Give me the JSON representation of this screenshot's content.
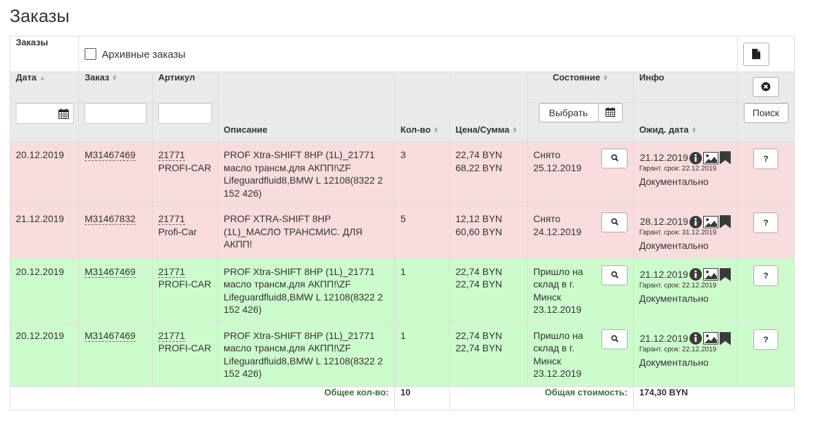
{
  "page_title": "Заказы",
  "top": {
    "label": "Заказы",
    "archive_label": "Архивные заказы"
  },
  "headers": {
    "date": "Дата",
    "order": "Заказ",
    "article": "Артикул",
    "description": "Описание",
    "qty": "Кол-во",
    "price": "Цена/Сумма",
    "status": "Состояние",
    "info": "Инфо",
    "expected": "Ожид. дата",
    "choose_button": "Выбрать",
    "search_button": "Поиск"
  },
  "rows": [
    {
      "state": "red",
      "date": "20.12.2019",
      "order": "M31467469",
      "article_code": "21771",
      "article_brand": "PROFI-CAR",
      "description": "PROF Xtra-SHIFT 8HP (1L)_21771 масло трансм.для АКПП!\\ZF Lifeguardfluid8,BMW L 12108(8322 2 152 426)",
      "qty": "3",
      "price": "22,74 BYN",
      "sum": "68,22 BYN",
      "status_text": "Снято",
      "status_date": "25.12.2019",
      "expected_date": "21.12.2019",
      "warranty": "Гарант. срок: 22.12.2019",
      "doc": "Документально",
      "question": "?"
    },
    {
      "state": "red",
      "date": "21.12.2019",
      "order": "M31467832",
      "article_code": "21771",
      "article_brand": "Profi-Car",
      "description": "PROF XTRA-SHIFT 8HP (1L)_МАСЛО ТРАНСМИС. ДЛЯ АКПП!",
      "qty": "5",
      "price": "12,12 BYN",
      "sum": "60,60 BYN",
      "status_text": "Снято",
      "status_date": "24.12.2019",
      "expected_date": "28.12.2019",
      "warranty": "Гарант. срок: 31.12.2019",
      "doc": "Документально",
      "question": "?"
    },
    {
      "state": "green",
      "date": "20.12.2019",
      "order": "M31467469",
      "article_code": "21771",
      "article_brand": "PROFI-CAR",
      "description": "PROF Xtra-SHIFT 8HP (1L)_21771 масло трансм.для АКПП!\\ZF Lifeguardfluid8,BMW L 12108(8322 2 152 426)",
      "qty": "1",
      "price": "22,74 BYN",
      "sum": "22,74 BYN",
      "status_text": "Пришло на склад в г. Минск",
      "status_date": "23.12.2019",
      "expected_date": "21.12.2019",
      "warranty": "Гарант. срок: 22.12.2019",
      "doc": "Документально",
      "question": "?"
    },
    {
      "state": "green",
      "date": "20.12.2019",
      "order": "M31467469",
      "article_code": "21771",
      "article_brand": "PROFI-CAR",
      "description": "PROF Xtra-SHIFT 8HP (1L)_21771 масло трансм.для АКПП!\\ZF Lifeguardfluid8,BMW L 12108(8322 2 152 426)",
      "qty": "1",
      "price": "22,74 BYN",
      "sum": "22,74 BYN",
      "status_text": "Пришло на склад в г. Минск",
      "status_date": "23.12.2019",
      "expected_date": "21.12.2019",
      "warranty": "Гарант. срок: 22.12.2019",
      "doc": "Документально",
      "question": "?"
    }
  ],
  "footer": {
    "total_qty_label": "Общее кол-во:",
    "total_qty": "10",
    "total_cost_label": "Общая стоимость:",
    "total_cost": "174,30 BYN"
  },
  "colors": {
    "row_red": "#f9dcdd",
    "row_green": "#ccfbcc",
    "header_bg": "#eaeaea",
    "footer_label": "#3b6e3b"
  },
  "icons": {
    "export": "file-icon",
    "clear": "clear-filter-icon",
    "calendar": "calendar-icon",
    "search": "magnifier-icon",
    "info": "info-icon",
    "photo": "image-icon",
    "bookmark": "bookmark-icon"
  }
}
